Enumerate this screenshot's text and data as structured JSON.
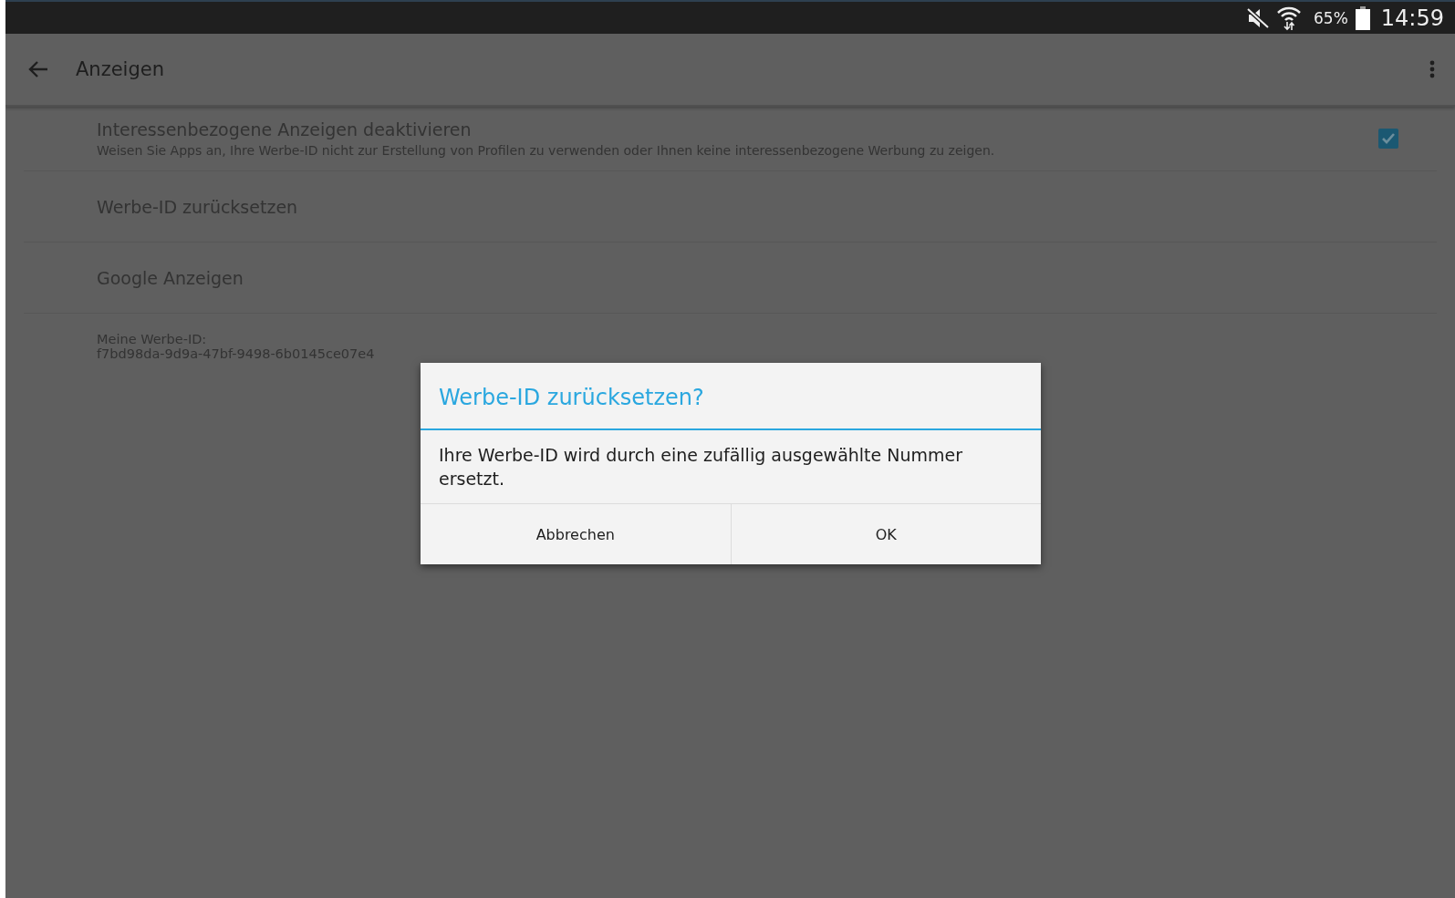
{
  "status_bar": {
    "battery": "65%",
    "time": "14:59"
  },
  "toolbar": {
    "title": "Anzeigen"
  },
  "settings": [
    {
      "kind": "checkbox",
      "title": "Interessenbezogene Anzeigen deaktivieren",
      "summary": "Weisen Sie Apps an, Ihre Werbe-ID nicht zur Erstellung von Profilen zu verwenden oder Ihnen keine interessenbezogene Werbung zu zeigen.",
      "checked": true
    },
    {
      "kind": "plain",
      "title": "Werbe-ID zurücksetzen"
    },
    {
      "kind": "plain",
      "title": "Google Anzeigen"
    }
  ],
  "advertising_id": {
    "label": "Meine Werbe-ID:",
    "value": "f7bd98da-9d9a-47bf-9498-6b0145ce07e4"
  },
  "dialog": {
    "title": "Werbe-ID zurücksetzen?",
    "message": "Ihre Werbe-ID wird durch eine zufällig ausgewählte Nummer ersetzt.",
    "buttons": [
      "Abbrechen",
      "OK"
    ]
  }
}
